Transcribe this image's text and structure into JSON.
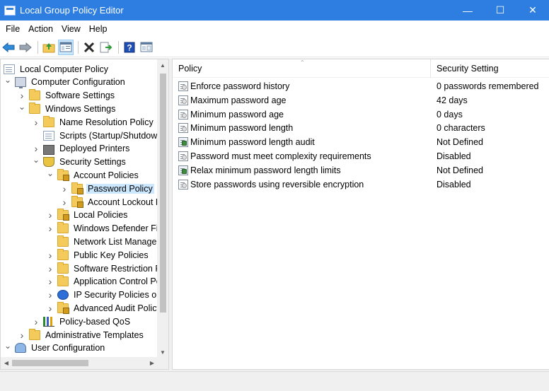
{
  "window": {
    "title": "Local Group Policy Editor",
    "controls": {
      "minimize": "—",
      "maximize": "☐",
      "close": "✕"
    }
  },
  "menu": [
    "File",
    "Action",
    "View",
    "Help"
  ],
  "toolbar": {
    "buttons": [
      "back-icon",
      "forward-icon",
      "up-folder-icon",
      "show-hide-tree-icon",
      "delete-icon",
      "export-list-icon",
      "help-icon",
      "properties-pane-icon"
    ]
  },
  "tree": {
    "items": [
      {
        "label": "Local Computer Policy",
        "icon": "book-icon",
        "expander": ""
      },
      {
        "label": "Computer Configuration",
        "icon": "computer-icon",
        "expander": "open"
      },
      {
        "label": "Software Settings",
        "icon": "folder-icon",
        "expander": "closed"
      },
      {
        "label": "Windows Settings",
        "icon": "folder-icon",
        "expander": "open"
      },
      {
        "label": "Name Resolution Policy",
        "icon": "folder-icon",
        "expander": "closed"
      },
      {
        "label": "Scripts (Startup/Shutdown)",
        "icon": "script-icon",
        "expander": ""
      },
      {
        "label": "Deployed Printers",
        "icon": "printer-icon",
        "expander": "closed"
      },
      {
        "label": "Security Settings",
        "icon": "shield-icon",
        "expander": "open"
      },
      {
        "label": "Account Policies",
        "icon": "lock-folder-icon",
        "expander": "open"
      },
      {
        "label": "Password Policy",
        "icon": "lock-folder-icon",
        "expander": "closed",
        "selected": true
      },
      {
        "label": "Account Lockout Policy",
        "icon": "lock-folder-icon",
        "expander": "closed"
      },
      {
        "label": "Local Policies",
        "icon": "lock-folder-icon",
        "expander": "closed"
      },
      {
        "label": "Windows Defender Firewall",
        "icon": "folder-icon",
        "expander": "closed"
      },
      {
        "label": "Network List Manager",
        "icon": "folder-icon",
        "expander": ""
      },
      {
        "label": "Public Key Policies",
        "icon": "folder-icon",
        "expander": "closed"
      },
      {
        "label": "Software Restriction Policies",
        "icon": "folder-icon",
        "expander": "closed"
      },
      {
        "label": "Application Control Policies",
        "icon": "folder-icon",
        "expander": "closed"
      },
      {
        "label": "IP Security Policies on",
        "icon": "ipsec-icon",
        "expander": "closed"
      },
      {
        "label": "Advanced Audit Policy",
        "icon": "lock-folder-icon",
        "expander": "closed"
      },
      {
        "label": "Policy-based QoS",
        "icon": "qos-chart-icon",
        "expander": "closed"
      },
      {
        "label": "Administrative Templates",
        "icon": "folder-icon",
        "expander": "closed"
      },
      {
        "label": "User Configuration",
        "icon": "users-icon",
        "expander": "open"
      }
    ]
  },
  "list": {
    "columns": {
      "policy": "Policy",
      "setting": "Security Setting"
    },
    "rows": [
      {
        "policy": "Enforce password history",
        "setting": "0 passwords remembered",
        "icon": "policy-icon"
      },
      {
        "policy": "Maximum password age",
        "setting": "42 days",
        "icon": "policy-icon"
      },
      {
        "policy": "Minimum password age",
        "setting": "0 days",
        "icon": "policy-icon"
      },
      {
        "policy": "Minimum password length",
        "setting": "0 characters",
        "icon": "policy-icon"
      },
      {
        "policy": "Minimum password length audit",
        "setting": "Not Defined",
        "icon": "policy-audit-icon"
      },
      {
        "policy": "Password must meet complexity requirements",
        "setting": "Disabled",
        "icon": "policy-icon"
      },
      {
        "policy": "Relax minimum password length limits",
        "setting": "Not Defined",
        "icon": "policy-audit-icon"
      },
      {
        "policy": "Store passwords using reversible encryption",
        "setting": "Disabled",
        "icon": "policy-icon"
      }
    ]
  }
}
